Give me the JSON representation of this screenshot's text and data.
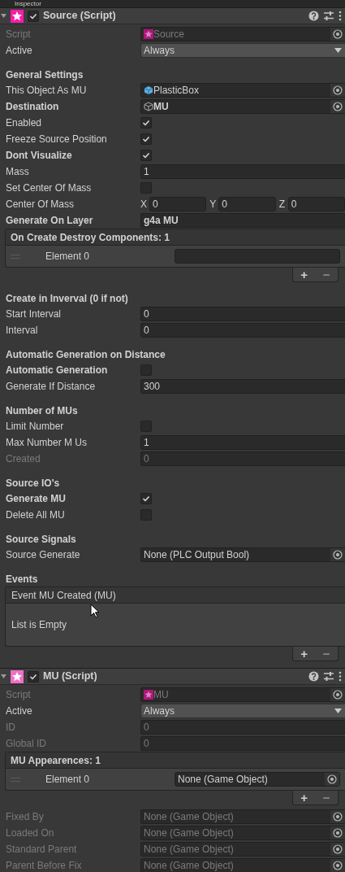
{
  "panel": {
    "title": "Inspector"
  },
  "components": [
    {
      "title": "Source (Script)",
      "enabled": true,
      "expanded": true,
      "rows": [
        {
          "kind": "script",
          "label": "Script",
          "value": "Source",
          "disabled": true,
          "modified": false
        },
        {
          "kind": "dropdown",
          "label": "Active",
          "value": "Always",
          "disabled": false,
          "modified": false
        },
        {
          "kind": "heading",
          "label": "General Settings"
        },
        {
          "kind": "prefab",
          "label": "This Object As MU",
          "value": "PlasticBox",
          "disabled": false,
          "modified": false
        },
        {
          "kind": "gameobject",
          "label": "Destination",
          "value": "MU",
          "disabled": false,
          "modified": true
        },
        {
          "kind": "check",
          "label": "Enabled",
          "checked": true,
          "modified": false
        },
        {
          "kind": "check",
          "label": "Freeze Source Position",
          "checked": true,
          "modified": false
        },
        {
          "kind": "check",
          "label": "Dont Visualize",
          "checked": true,
          "modified": true
        },
        {
          "kind": "text",
          "label": "Mass",
          "value": "1",
          "disabled": false,
          "modified": false
        },
        {
          "kind": "check",
          "label": "Set Center Of Mass",
          "checked": false,
          "modified": false
        },
        {
          "kind": "vector",
          "label": "Center Of Mass",
          "modified": false,
          "axes": [
            {
              "axis": "X",
              "value": "0"
            },
            {
              "axis": "Y",
              "value": "0"
            },
            {
              "axis": "Z",
              "value": "0"
            }
          ]
        },
        {
          "kind": "text",
          "label": "Generate On Layer",
          "value": "g4a MU",
          "disabled": false,
          "modified": true
        },
        {
          "kind": "list",
          "title": "On Create Destroy Components: 1",
          "add": "+",
          "remove": "−",
          "elements": [
            {
              "label": "Element 0",
              "kind": "text"
            }
          ]
        },
        {
          "kind": "heading",
          "label": "Create in Inverval (0 if not)"
        },
        {
          "kind": "text",
          "label": "Start Interval",
          "value": "0",
          "disabled": false,
          "modified": false
        },
        {
          "kind": "text",
          "label": "Interval",
          "value": "0",
          "disabled": false,
          "modified": false
        },
        {
          "kind": "heading",
          "label": "Automatic Generation on Distance"
        },
        {
          "kind": "check",
          "label": "Automatic Generation",
          "checked": false,
          "modified": true
        },
        {
          "kind": "text",
          "label": "Generate If Distance",
          "value": "300",
          "disabled": false,
          "modified": false
        },
        {
          "kind": "heading",
          "label": "Number of MUs"
        },
        {
          "kind": "check",
          "label": "Limit Number",
          "checked": false,
          "modified": false
        },
        {
          "kind": "text",
          "label": "Max Number M Us",
          "value": "1",
          "disabled": false,
          "modified": false
        },
        {
          "kind": "text",
          "label": "Created",
          "value": "0",
          "disabled": true,
          "modified": false
        },
        {
          "kind": "heading",
          "label": "Source IO's"
        },
        {
          "kind": "check",
          "label": "Generate MU",
          "checked": true,
          "modified": true
        },
        {
          "kind": "check",
          "label": "Delete All MU",
          "checked": false,
          "modified": false
        },
        {
          "kind": "heading",
          "label": "Source Signals"
        },
        {
          "kind": "object",
          "label": "Source Generate",
          "value": "None (PLC Output Bool)",
          "disabled": false,
          "modified": false
        },
        {
          "kind": "heading",
          "label": "Events"
        },
        {
          "kind": "event",
          "title": "Event MU Created (MU)",
          "empty_text": "List is Empty",
          "add": "+",
          "remove": "−"
        }
      ]
    },
    {
      "title": "MU (Script)",
      "enabled": true,
      "expanded": true,
      "rows": [
        {
          "kind": "script",
          "label": "Script",
          "value": "MU",
          "disabled": true,
          "modified": false
        },
        {
          "kind": "dropdown",
          "label": "Active",
          "value": "Always",
          "disabled": false,
          "modified": false
        },
        {
          "kind": "text",
          "label": "ID",
          "value": "0",
          "disabled": true,
          "modified": false
        },
        {
          "kind": "text",
          "label": "Global ID",
          "value": "0",
          "disabled": true,
          "modified": false
        },
        {
          "kind": "list",
          "title": "MU Appearences: 1",
          "add": "+",
          "remove": "−",
          "elements": [
            {
              "label": "Element 0",
              "kind": "object",
              "value": "None (Game Object)"
            }
          ]
        },
        {
          "kind": "object",
          "label": "Fixed By",
          "value": "None (Game Object)",
          "disabled": true,
          "modified": false
        },
        {
          "kind": "object",
          "label": "Loaded On",
          "value": "None (Game Object)",
          "disabled": true,
          "modified": false
        },
        {
          "kind": "object",
          "label": "Standard Parent",
          "value": "None (Game Object)",
          "disabled": true,
          "modified": false
        },
        {
          "kind": "object",
          "label": "Parent Before Fix",
          "value": "None (Game Object)",
          "disabled": true,
          "modified": false
        }
      ]
    }
  ]
}
